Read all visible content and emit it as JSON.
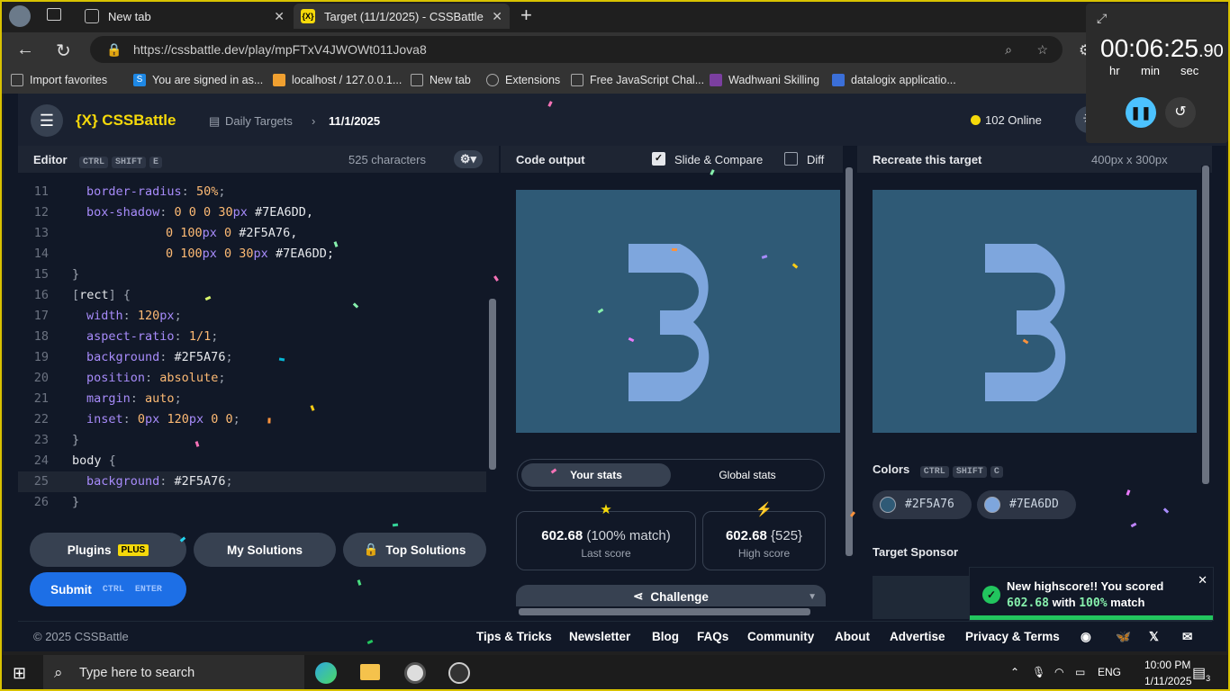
{
  "browser": {
    "tabs": [
      {
        "title": "New tab"
      },
      {
        "title": "Target (11/1/2025) - CSSBattle"
      }
    ],
    "url": "https://cssbattle.dev/play/mpFTxV4JWOWt011Jova8",
    "bookmarks": [
      {
        "label": "Import favorites",
        "color": "#888888"
      },
      {
        "label": "You are signed in as...",
        "color": "#1e88e5"
      },
      {
        "label": "localhost / 127.0.0.1...",
        "color": "#f0a030"
      },
      {
        "label": "New tab",
        "color": "#aaaaaa"
      },
      {
        "label": "Extensions",
        "color": "#aaaaaa"
      },
      {
        "label": "Free JavaScript Chal...",
        "color": "#aaaaaa"
      },
      {
        "label": "Wadhwani Skilling",
        "color": "#7b3fa0"
      },
      {
        "label": "datalogix applicatio...",
        "color": "#3b6fd8"
      }
    ]
  },
  "header": {
    "logo": "{X} CSSBattle",
    "crumb_daily": "Daily Targets",
    "crumb_date": "11/1/2025",
    "online": "102 Online"
  },
  "editor": {
    "title": "Editor",
    "shortcut": [
      "CTRL",
      "SHIFT",
      "E"
    ],
    "chars": "525 characters",
    "lines": [
      {
        "n": "11",
        "seg": [
          [
            "p",
            "border-radius"
          ],
          [
            "c",
            ": "
          ],
          [
            "v",
            "50%"
          ],
          [
            "c",
            ";"
          ]
        ],
        "indent": 1
      },
      {
        "n": "12",
        "seg": [
          [
            "p",
            "box-shadow"
          ],
          [
            "c",
            ": "
          ],
          [
            "v",
            "0 0 0 30"
          ],
          [
            "p",
            "px"
          ],
          [
            "s",
            " #7EA6DD,"
          ]
        ],
        "indent": 1
      },
      {
        "n": "13",
        "seg": [
          [
            "v",
            "0 100"
          ],
          [
            "p",
            "px"
          ],
          [
            "v",
            " 0 "
          ],
          [
            "s",
            "#2F5A76,"
          ]
        ],
        "indent": 2
      },
      {
        "n": "14",
        "seg": [
          [
            "v",
            "0 100"
          ],
          [
            "p",
            "px"
          ],
          [
            "v",
            " 0 30"
          ],
          [
            "p",
            "px"
          ],
          [
            "s",
            " #7EA6DD;"
          ]
        ],
        "indent": 2
      },
      {
        "n": "15",
        "seg": [
          [
            "c",
            "}"
          ]
        ],
        "indent": 0
      },
      {
        "n": "16",
        "seg": [
          [
            "c",
            "["
          ],
          [
            "s",
            "rect"
          ],
          [
            "c",
            "] {"
          ]
        ],
        "indent": 0
      },
      {
        "n": "17",
        "seg": [
          [
            "p",
            "width"
          ],
          [
            "c",
            ": "
          ],
          [
            "v",
            "120"
          ],
          [
            "p",
            "px"
          ],
          [
            "c",
            ";"
          ]
        ],
        "indent": 1
      },
      {
        "n": "18",
        "seg": [
          [
            "p",
            "aspect-ratio"
          ],
          [
            "c",
            ": "
          ],
          [
            "v",
            "1/1"
          ],
          [
            "c",
            ";"
          ]
        ],
        "indent": 1
      },
      {
        "n": "19",
        "seg": [
          [
            "p",
            "background"
          ],
          [
            "c",
            ": "
          ],
          [
            "s",
            "#2F5A76"
          ],
          [
            "c",
            ";"
          ]
        ],
        "indent": 1
      },
      {
        "n": "20",
        "seg": [
          [
            "p",
            "position"
          ],
          [
            "c",
            ": "
          ],
          [
            "v",
            "absolute"
          ],
          [
            "c",
            ";"
          ]
        ],
        "indent": 1
      },
      {
        "n": "21",
        "seg": [
          [
            "p",
            "margin"
          ],
          [
            "c",
            ": "
          ],
          [
            "v",
            "auto"
          ],
          [
            "c",
            ";"
          ]
        ],
        "indent": 1
      },
      {
        "n": "22",
        "seg": [
          [
            "p",
            "inset"
          ],
          [
            "c",
            ": "
          ],
          [
            "v",
            "0"
          ],
          [
            "p",
            "px"
          ],
          [
            "v",
            " 120"
          ],
          [
            "p",
            "px"
          ],
          [
            "v",
            " 0 0"
          ],
          [
            "c",
            ";"
          ]
        ],
        "indent": 1
      },
      {
        "n": "23",
        "seg": [
          [
            "c",
            "}"
          ]
        ],
        "indent": 0
      },
      {
        "n": "24",
        "seg": [
          [
            "s",
            "body"
          ],
          [
            "c",
            " {"
          ]
        ],
        "indent": 0
      },
      {
        "n": "25",
        "seg": [
          [
            "p",
            "background"
          ],
          [
            "c",
            ": "
          ],
          [
            "s",
            "#2F5A76"
          ],
          [
            "c",
            ";"
          ]
        ],
        "indent": 1
      },
      {
        "n": "26",
        "seg": [
          [
            "c",
            "}"
          ]
        ],
        "indent": 0
      }
    ],
    "buttons": {
      "plugins": "Plugins",
      "plus": "PLUS",
      "solutions": "My Solutions",
      "top": "Top Solutions",
      "submit": "Submit",
      "submit_keys": [
        "CTRL",
        "ENTER"
      ]
    }
  },
  "output": {
    "title": "Code output",
    "slide": "Slide & Compare",
    "diff": "Diff",
    "tab_your": "Your stats",
    "tab_global": "Global stats",
    "last_score": "602.68",
    "last_match": "(100% match)",
    "last_label": "Last score",
    "high_score": "602.68",
    "high_chars": "{525}",
    "high_label": "High score",
    "challenge": "Challenge"
  },
  "target": {
    "title": "Recreate this target",
    "size": "400px x 300px",
    "colors_label": "Colors",
    "colors_keys": [
      "CTRL",
      "SHIFT",
      "C"
    ],
    "colors": [
      "#2F5A76",
      "#7EA6DD"
    ],
    "sponsor": "Target Sponsor"
  },
  "footer": {
    "copyright": "© 2025 CSSBattle",
    "links": [
      "Tips & Tricks",
      "Newsletter",
      "Blog",
      "FAQs",
      "Community",
      "About",
      "Advertise",
      "Privacy & Terms"
    ]
  },
  "toast": {
    "line1": "New highscore!! You scored",
    "score": "602.68",
    "with": "with",
    "pct": "100%",
    "match": "match"
  },
  "timer": {
    "time": "00:06:25",
    "frac": ".90",
    "hr": "hr",
    "min": "min",
    "sec": "sec"
  },
  "taskbar": {
    "search": "Type here to search",
    "lang": "ENG",
    "time": "10:00 PM",
    "date": "1/11/2025",
    "notif": "3"
  }
}
